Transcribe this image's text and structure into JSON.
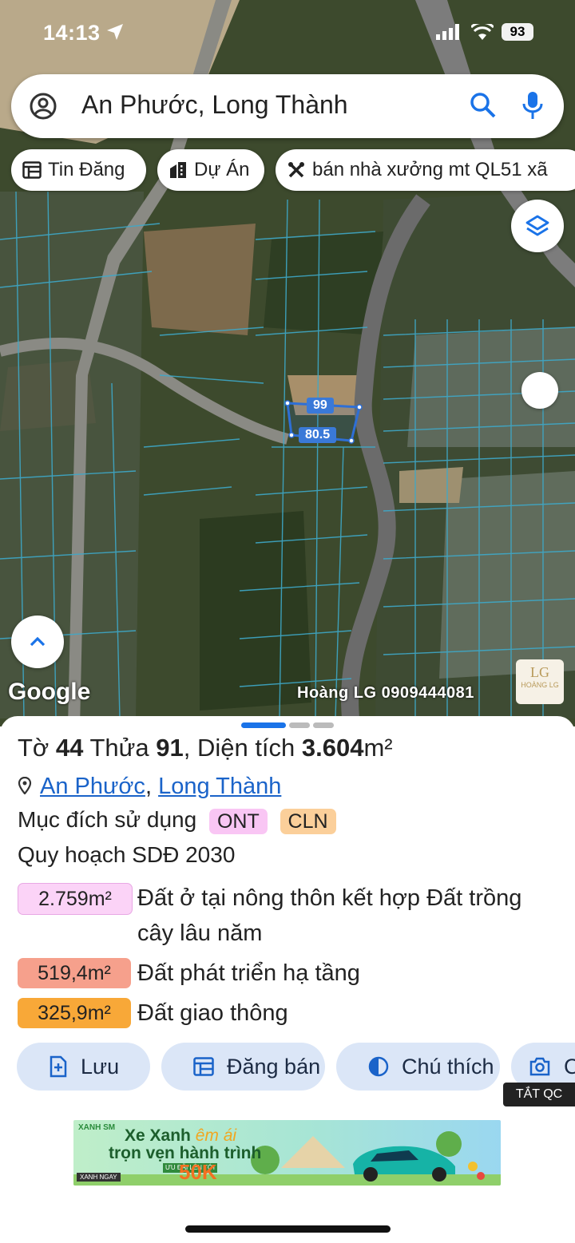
{
  "status_bar": {
    "time": "14:13",
    "battery": "93"
  },
  "search": {
    "query": "An Phước, Long Thành"
  },
  "chips": [
    {
      "label": "Tin Đăng",
      "icon": "listing-icon"
    },
    {
      "label": "Dự Án",
      "icon": "building-icon"
    },
    {
      "label": "bán nhà xưởng mt QL51 xã",
      "icon": "tools-icon"
    }
  ],
  "map": {
    "parcel_edge_top": "99",
    "parcel_edge_bottom": "80.5",
    "google_logo": "Google",
    "watermark": "Hoàng LG 0909444081",
    "watermark_logo": {
      "mark": "LG",
      "name": "HOÀNG LG"
    }
  },
  "parcel": {
    "sheet_prefix": "Tờ",
    "sheet_no": "44",
    "lot_prefix": "Thửa",
    "lot_no": "91",
    "area_prefix": ", Diện tích",
    "area": "3.604",
    "area_unit": "m²",
    "commune": "An Phước",
    "district": "Long Thành",
    "purpose_label": "Mục đích sử dụng",
    "purpose_tags": [
      "ONT",
      "CLN"
    ],
    "plan_label": "Quy hoạch SDĐ 2030",
    "zones": [
      {
        "area": "2.759m²",
        "desc_line1": "Đất ở tại nông thôn kết hợp Đất trồng",
        "desc_line2": "cây lâu năm",
        "color": "#fbd3f7"
      },
      {
        "area": "519,4m²",
        "desc_line1": "Đất phát triển hạ tầng",
        "color": "#f6a08c"
      },
      {
        "area": "325,9m²",
        "desc_line1": "Đất giao thông",
        "color": "#f8a838"
      }
    ]
  },
  "actions": [
    {
      "label": "Lưu",
      "icon": "save-icon"
    },
    {
      "label": "Đăng bán",
      "icon": "post-sale-icon"
    },
    {
      "label": "Chú thích",
      "icon": "legend-icon"
    },
    {
      "label": "Chụp",
      "icon": "camera-icon"
    }
  ],
  "ad_off": "TẮT QC",
  "ad": {
    "brand": "XANH SM",
    "line1a": "Xe Xanh",
    "line1b": "êm ái",
    "line2": "trọn vẹn hành trình",
    "promo": "ƯU ĐÃI LÊN TỚI",
    "value": "50K",
    "cta": "XANH NGAY"
  },
  "colors": {
    "accent": "#1a63c9",
    "button_bg": "#dbe6f7",
    "ont": "#f9c6f4",
    "cln": "#fbcf9a"
  }
}
